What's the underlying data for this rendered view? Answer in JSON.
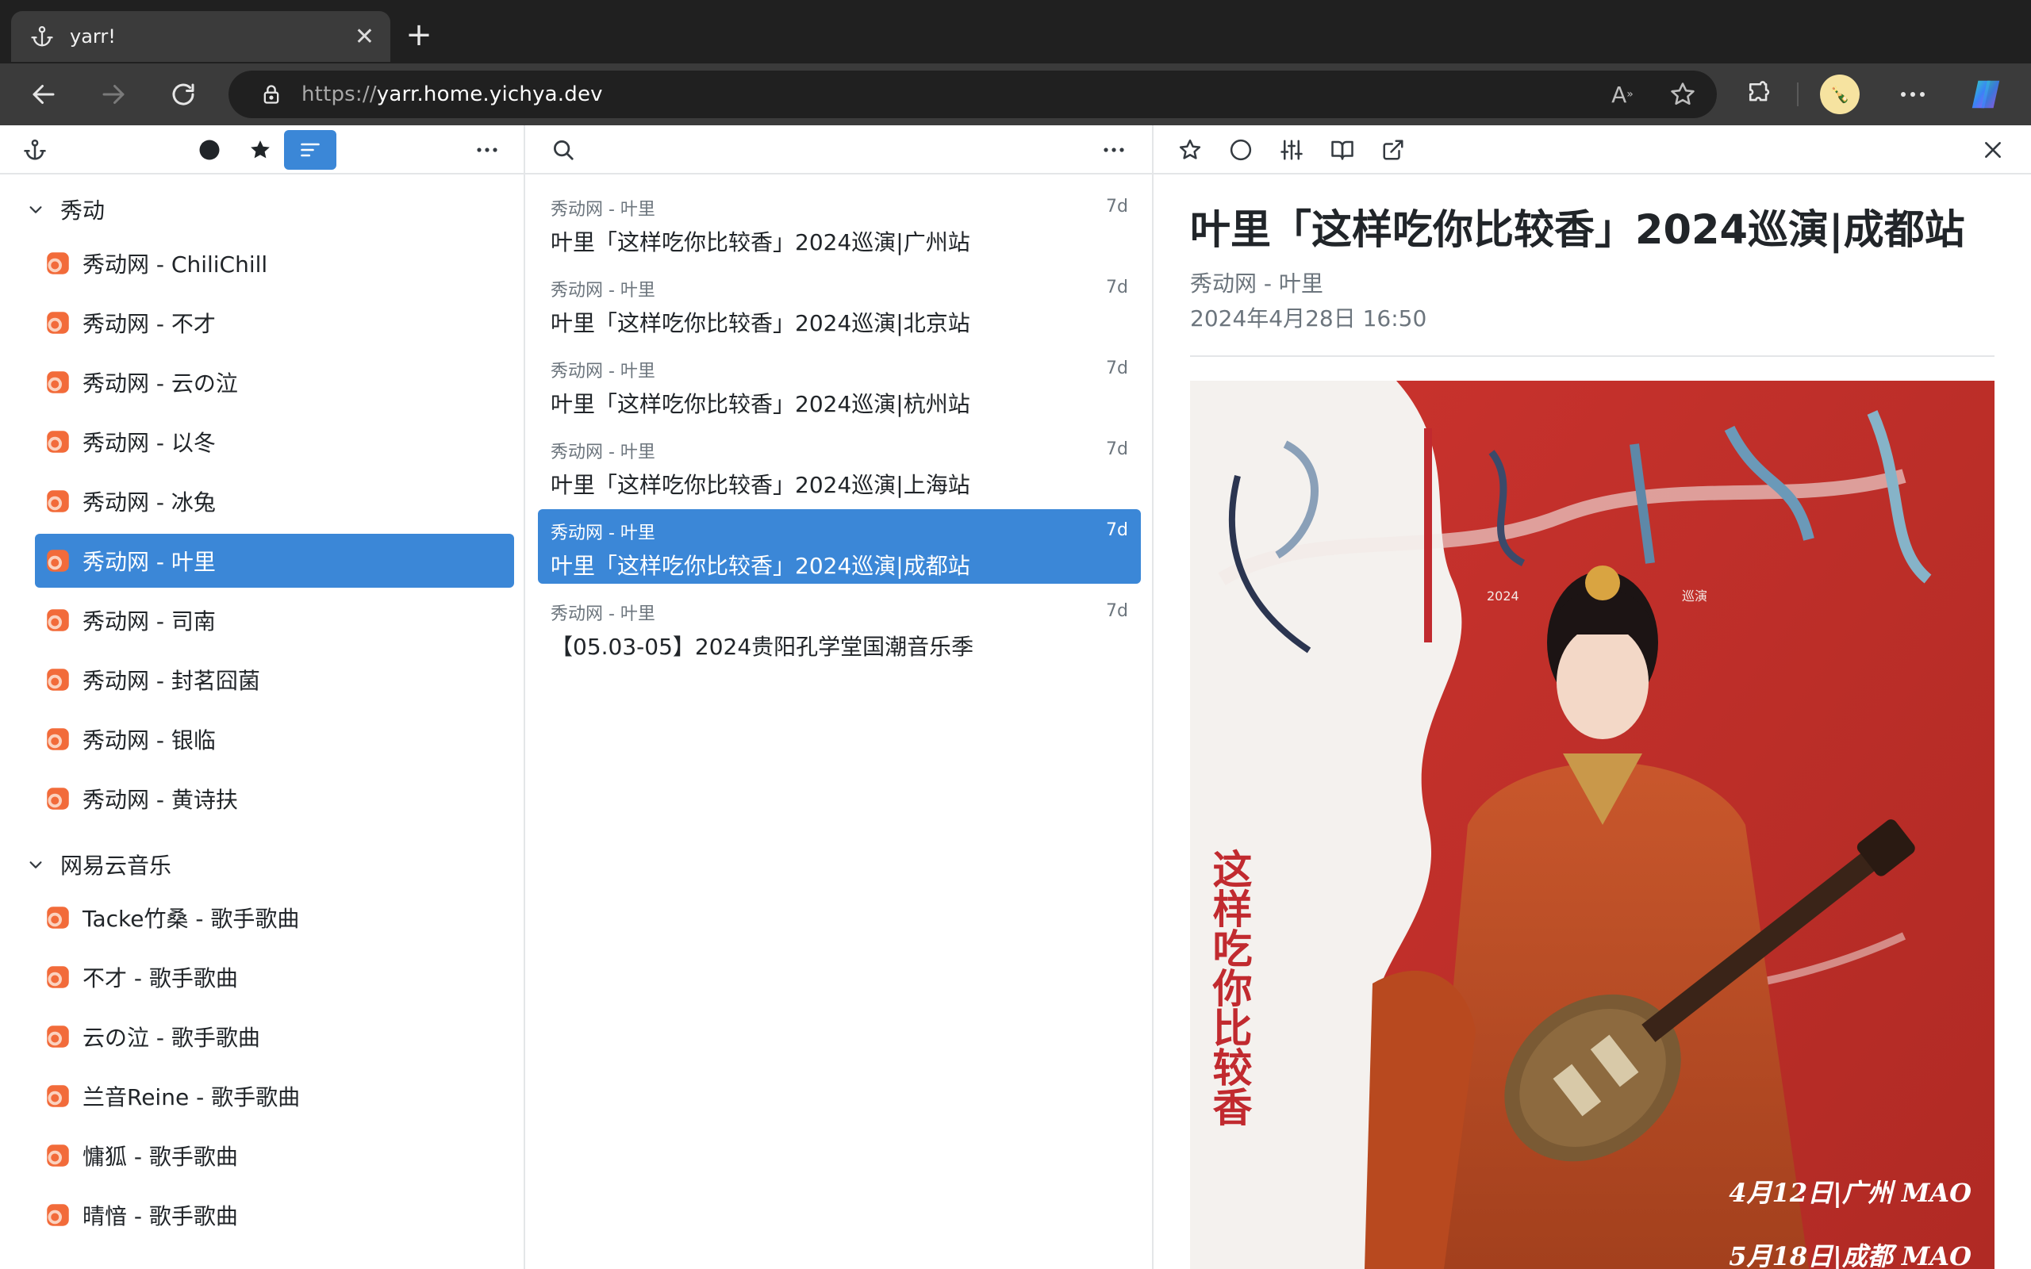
{
  "browser": {
    "tab_title": "yarr!",
    "url_scheme": "https://",
    "url_host": "yarr.home.yichya.dev",
    "colors": {
      "chrome_dark": "#202020",
      "toolbar": "#3b3b3b"
    },
    "icons": [
      "anchor-icon",
      "close-icon",
      "plus-icon",
      "back-icon",
      "forward-icon",
      "refresh-icon",
      "lock-icon",
      "read-aloud-icon",
      "favorite-star-icon",
      "extensions-icon",
      "profile-avatar",
      "more-icon",
      "copilot-icon"
    ]
  },
  "feeds_pane": {
    "toolbar_icons": [
      "anchor-icon",
      "unread-filter-icon",
      "starred-filter-icon",
      "all-filter-icon",
      "more-icon"
    ],
    "folders": [
      {
        "label": "秀动",
        "feeds": [
          "秀动网 - ChiliChill",
          "秀动网 - 不才",
          "秀动网 - 云の泣",
          "秀动网 - 以冬",
          "秀动网 - 冰兔",
          "秀动网 - 叶里",
          "秀动网 - 司南",
          "秀动网 - 封茗囧菌",
          "秀动网 - 银临",
          "秀动网 - 黄诗扶"
        ]
      },
      {
        "label": "网易云音乐",
        "feeds": [
          "Tacke竹桑 - 歌手歌曲",
          "不才 - 歌手歌曲",
          "云の泣 - 歌手歌曲",
          "兰音Reine - 歌手歌曲",
          "慵狐 - 歌手歌曲",
          "晴愔 - 歌手歌曲"
        ]
      }
    ],
    "selected_feed": "秀动网 - 叶里",
    "colors": {
      "selected": "#3b87d7",
      "feed_icon": "#f26b3a"
    }
  },
  "items_pane": {
    "items": [
      {
        "source": "秀动网 - 叶里",
        "age": "7d",
        "title": "叶里「这样吃你比较香」2024巡演|广州站"
      },
      {
        "source": "秀动网 - 叶里",
        "age": "7d",
        "title": "叶里「这样吃你比较香」2024巡演|北京站"
      },
      {
        "source": "秀动网 - 叶里",
        "age": "7d",
        "title": "叶里「这样吃你比较香」2024巡演|杭州站"
      },
      {
        "source": "秀动网 - 叶里",
        "age": "7d",
        "title": "叶里「这样吃你比较香」2024巡演|上海站"
      },
      {
        "source": "秀动网 - 叶里",
        "age": "7d",
        "title": "叶里「这样吃你比较香」2024巡演|成都站"
      },
      {
        "source": "秀动网 - 叶里",
        "age": "7d",
        "title": "【05.03-05】2024贵阳孔学堂国潮音乐季"
      }
    ],
    "selected_index": 4
  },
  "article": {
    "title": "叶里「这样吃你比较香」2024巡演|成都站",
    "feed": "秀动网 - 叶里",
    "date": "2024年4月28日 16:50",
    "poster": {
      "vertical_text": "这样吃你比较香",
      "year": "2024",
      "tour": "巡演",
      "stop1": "4月12日|广州 MAO",
      "stop2": "5月18日|成都 MAO"
    }
  }
}
